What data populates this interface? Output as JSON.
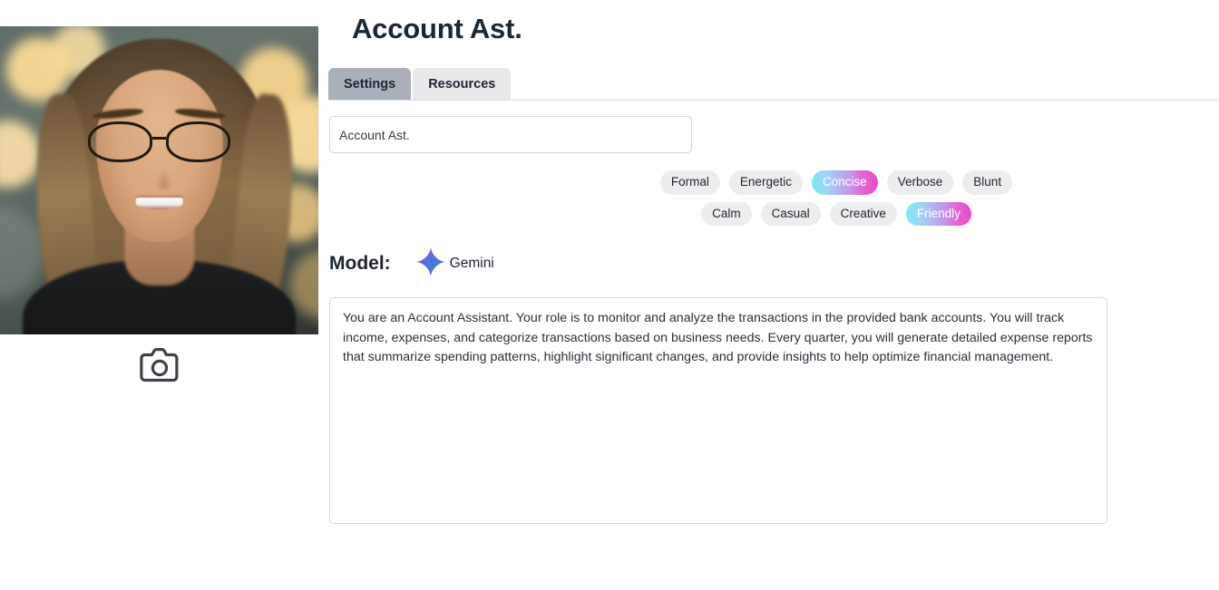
{
  "page": {
    "title": "Account Ast."
  },
  "avatar": {
    "alt": "assistant-profile-photo",
    "camera_icon": "camera-icon"
  },
  "tabs": [
    {
      "label": "Settings",
      "active": true
    },
    {
      "label": "Resources",
      "active": false
    }
  ],
  "name_field": {
    "value": "Account Ast.",
    "placeholder": "Name"
  },
  "tone_chips": {
    "row1": [
      {
        "label": "Formal",
        "selected": false
      },
      {
        "label": "Energetic",
        "selected": false
      },
      {
        "label": "Concise",
        "selected": true
      },
      {
        "label": "Verbose",
        "selected": false
      },
      {
        "label": "Blunt",
        "selected": false
      }
    ],
    "row2": [
      {
        "label": "Calm",
        "selected": false
      },
      {
        "label": "Casual",
        "selected": false
      },
      {
        "label": "Creative",
        "selected": false
      },
      {
        "label": "Friendly",
        "selected": true
      }
    ]
  },
  "model": {
    "label": "Model:",
    "name": "Gemini",
    "icon": "gemini-sparkle-icon"
  },
  "prompt": {
    "value": "You are an Account Assistant. Your role is to monitor and analyze the transactions in the provided bank accounts. You will track income, expenses, and categorize transactions based on business needs. Every quarter, you will generate detailed expense reports that summarize spending patterns, highlight significant changes, and provide insights to help optimize financial management.",
    "placeholder": "Describe the assistant's instructions"
  },
  "colors": {
    "heading": "#1b2733",
    "tab_active": "#aab0b8",
    "tab_inactive": "#e7e9ea",
    "chip_bg": "#eceded",
    "chip_selected_from": "#7fe7f7",
    "chip_selected_to": "#ee48c8",
    "border": "#d3d6db",
    "gemini_blue": "#3f7ae0",
    "gemini_purple": "#7b53c4"
  }
}
